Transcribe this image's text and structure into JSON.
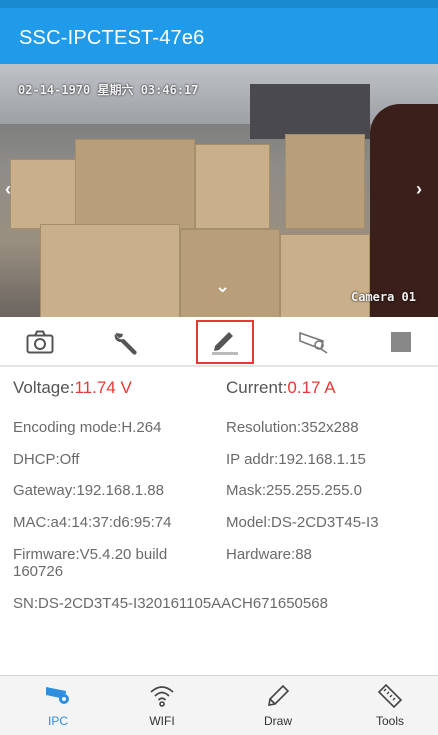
{
  "app": {
    "title": "SSC-IPCTEST-47e6"
  },
  "video": {
    "date_osd": "02-14-1970 星期六 03:46:17",
    "camera_label": "Camera 01",
    "nav": {
      "left": "‹",
      "right": "›",
      "down": "⌄"
    }
  },
  "toolbar": {
    "items": [
      {
        "name": "camera-icon",
        "selected": false
      },
      {
        "name": "wrench-icon",
        "selected": false
      },
      {
        "name": "pencil-icon",
        "selected": true
      },
      {
        "name": "cctv-camera-icon",
        "selected": false
      },
      {
        "name": "stop-icon",
        "selected": false
      }
    ]
  },
  "info": {
    "voltage_label": "Voltage:",
    "voltage_value": "11.74 V",
    "current_label": "Current:",
    "current_value": "0.17 A",
    "encoding": "Encoding mode:H.264",
    "resolution": "Resolution:352x288",
    "dhcp": "DHCP:Off",
    "ip": "IP addr:192.168.1.15",
    "gateway": "Gateway:192.168.1.88",
    "mask": "Mask:255.255.255.0",
    "mac": "MAC:a4:14:37:d6:95:74",
    "model": "Model:DS-2CD3T45-I3",
    "firmware_line1": "Firmware:V5.4.20 build",
    "firmware_line2": "160726",
    "hardware": "Hardware:88",
    "sn": "SN:DS-2CD3T45-I320161105AACH671650568"
  },
  "bottom_nav": {
    "items": [
      {
        "label": "IPC",
        "active": true
      },
      {
        "label": "WIFI",
        "active": false
      },
      {
        "label": "Draw",
        "active": false
      },
      {
        "label": "Tools",
        "active": false
      }
    ]
  },
  "colors": {
    "primary": "#209bea",
    "highlight": "#e53935",
    "active_tab": "#2e8fe0"
  }
}
